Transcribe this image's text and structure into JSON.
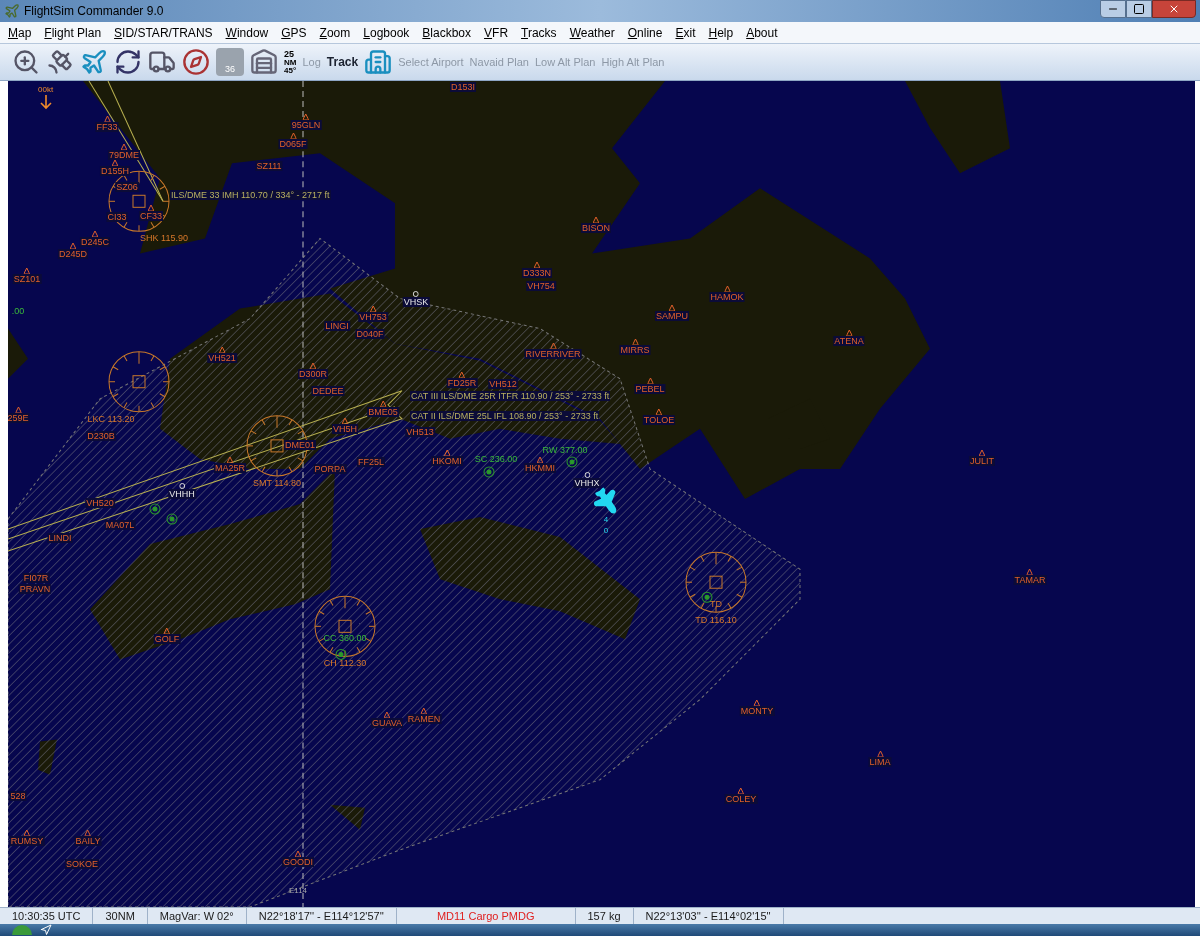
{
  "window": {
    "title": "FlightSim Commander 9.0"
  },
  "menu": [
    "Map",
    "Flight Plan",
    "SID/STAR/TRANS",
    "Window",
    "GPS",
    "Zoom",
    "Logbook",
    "Blackbox",
    "VFR",
    "Tracks",
    "Weather",
    "Online",
    "Exit",
    "Help",
    "About"
  ],
  "toolbar": {
    "range": "25",
    "range_unit": "NM",
    "angle": "45°",
    "runway_label": "36",
    "buttons": [
      {
        "label": "Log",
        "disabled": true
      },
      {
        "label": "Track",
        "disabled": false
      },
      {
        "label": "Select Airport",
        "disabled": true
      },
      {
        "label": "Navaid Plan",
        "disabled": true
      },
      {
        "label": "Low Alt Plan",
        "disabled": true
      },
      {
        "label": "High Alt Plan",
        "disabled": true
      }
    ]
  },
  "map": {
    "wind": "00kt",
    "waypoints": [
      "D153I",
      "FF33",
      "95GLN",
      "D065F",
      "79DME",
      "SZ111",
      "D155H",
      "SZ06",
      "CI33",
      "CF33",
      "BISON",
      "D245C",
      "D245D",
      "D333N",
      "SZ101",
      "VH754",
      "HAMOK",
      "SAMPU",
      "VH753",
      "LINGI",
      "D040F",
      "ATENA",
      "MIRRS",
      "RIVERRIVER",
      "VH521",
      "D300R",
      "DEDEE",
      "FD25R",
      "VH512",
      "PEBEL",
      "BME05",
      "259E",
      "TOLOE",
      "VH5H",
      "VH513",
      "D230B",
      "DME01",
      "FF25L",
      "HKOMI",
      "JULIT",
      "MA25R",
      "PORPA",
      "HKMMI",
      "VH520",
      "MA07L",
      "LINDI",
      "FI07R",
      "TAMAR",
      "PRAVN",
      "GOLF",
      "RAMEN",
      "GUAVA",
      "MONTY",
      "LIMA",
      "528",
      "COLEY",
      "RUMSY",
      "BAILY",
      "GOODI",
      "SOKOE"
    ],
    "navaids": [
      "SHK 115.90",
      "LKC 113.20",
      "SMT 114.80",
      "TD",
      "TD 116.10",
      "CH 112.30"
    ],
    "ils": [
      "ILS/DME 33 IMH 110.70 / 334° - 2717 ft",
      "CAT III ILS/DME 25R ITFR 110.90 / 253° - 2733 ft",
      "CAT II ILS/DME 25L IFL 108.90 / 253° - 2733 ft"
    ],
    "ndbs": [
      ".00",
      "SC 236.00",
      "RW 377.00",
      "CC 360.00"
    ],
    "airports": [
      "VHSK",
      "VHHH",
      "VHHX"
    ],
    "aircraft": {
      "altitude": "4",
      "speed": "0"
    },
    "grid_label": "E114"
  },
  "status_bar": [
    {
      "text": "10:30:35 UTC",
      "highlight": false
    },
    {
      "text": "30NM",
      "highlight": false
    },
    {
      "text": "MagVar: W 02°",
      "highlight": false
    },
    {
      "text": "N22°18'17'' - E114°12'57''",
      "highlight": false
    },
    {
      "text": "MD11 Cargo PMDG",
      "highlight": true
    },
    {
      "text": "157 kg",
      "highlight": false
    },
    {
      "text": "N22°13'03'' - E114°02'15''",
      "highlight": false
    }
  ]
}
